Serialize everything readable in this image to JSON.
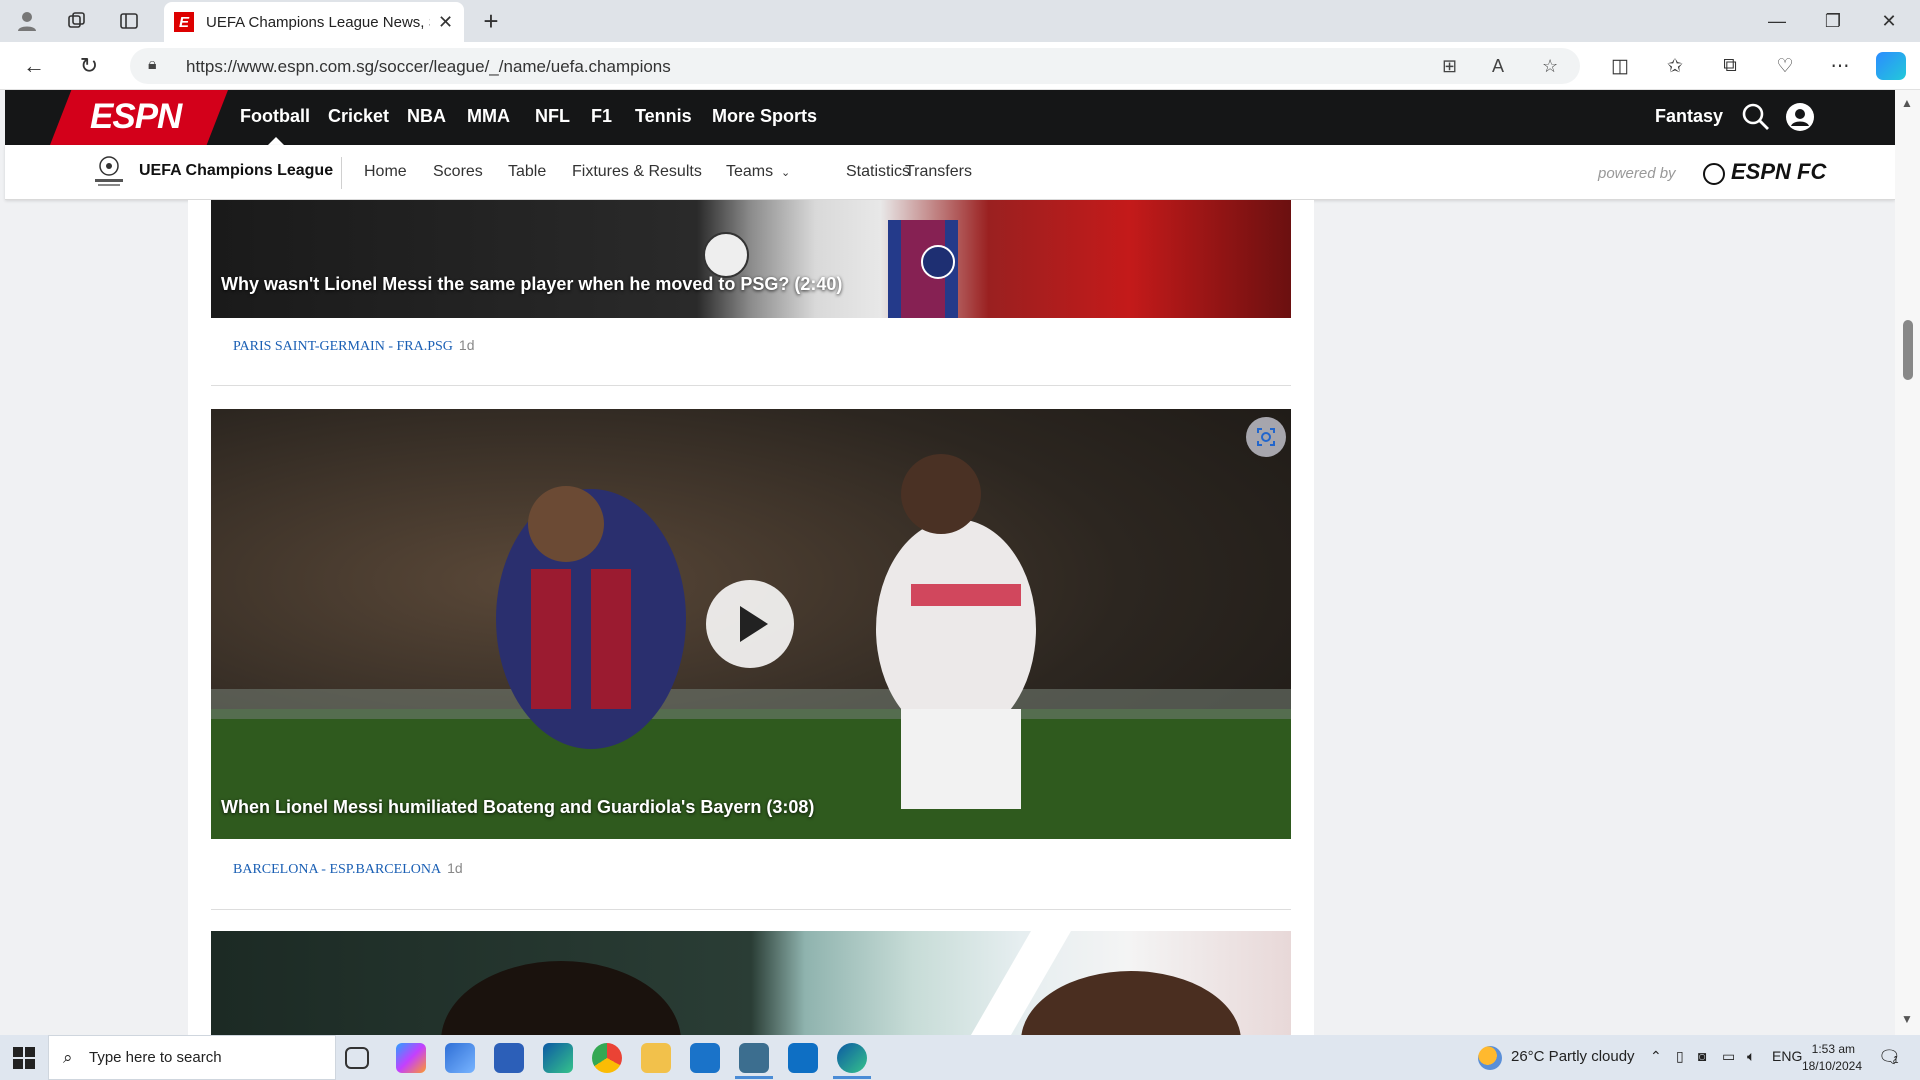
{
  "browser": {
    "tab_title": "UEFA Champions League News, S",
    "url": "https://www.espn.com.sg/soccer/league/_/name/uefa.champions"
  },
  "espn": {
    "logo": "ESPN",
    "sports": [
      "Football",
      "Cricket",
      "NBA",
      "MMA",
      "NFL",
      "F1",
      "Tennis",
      "More Sports"
    ],
    "active_sport": "Football",
    "fantasy": "Fantasy"
  },
  "league": {
    "name": "UEFA Champions League",
    "nav": [
      "Home",
      "Scores",
      "Table",
      "Fixtures & Results",
      "Teams",
      "Statistics",
      "Transfers"
    ],
    "powered_by": "powered by",
    "brand": "ESPN FC"
  },
  "articles": [
    {
      "caption": "Why wasn't Lionel Messi the same player when he moved to PSG? (2:40)",
      "tag": "PARIS SAINT-GERMAIN - FRA.PSG",
      "age": "1d"
    },
    {
      "caption": "When Lionel Messi humiliated Boateng and Guardiola's Bayern (3:08)",
      "tag": "BARCELONA - ESP.BARCELONA",
      "age": "1d"
    }
  ],
  "taskbar": {
    "search_placeholder": "Type here to search",
    "weather": "26°C  Partly cloudy",
    "language": "ENG",
    "time": "1:53 am",
    "date": "18/10/2024",
    "notifications": "1"
  }
}
